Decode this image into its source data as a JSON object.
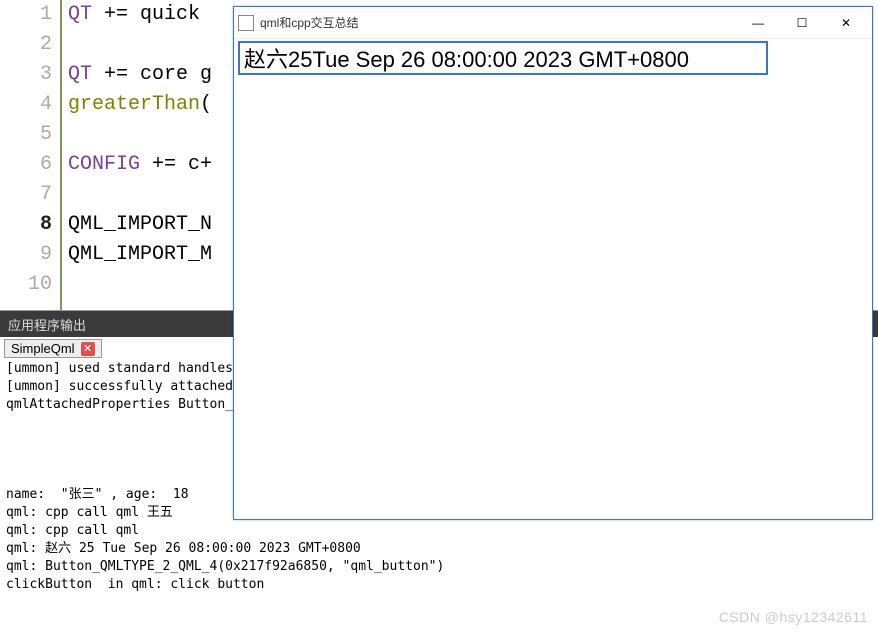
{
  "editor": {
    "lines": [
      {
        "num": "1",
        "tokens": [
          {
            "t": "QT",
            "c": "kw"
          },
          {
            "t": " += quick",
            "c": "id"
          }
        ]
      },
      {
        "num": "2",
        "tokens": []
      },
      {
        "num": "3",
        "tokens": [
          {
            "t": "QT",
            "c": "kw"
          },
          {
            "t": " += core g",
            "c": "id"
          }
        ]
      },
      {
        "num": "4",
        "tokens": [
          {
            "t": "greaterThan",
            "c": "fn"
          },
          {
            "t": "(",
            "c": "id"
          }
        ]
      },
      {
        "num": "5",
        "tokens": []
      },
      {
        "num": "6",
        "tokens": [
          {
            "t": "CONFIG",
            "c": "kw"
          },
          {
            "t": " += c+",
            "c": "id"
          }
        ]
      },
      {
        "num": "7",
        "tokens": []
      },
      {
        "num": "8",
        "tokens": [
          {
            "t": "QML_IMPORT_N",
            "c": "id"
          }
        ]
      },
      {
        "num": "9",
        "tokens": [
          {
            "t": "QML_IMPORT_M",
            "c": "id"
          }
        ]
      },
      {
        "num": "10",
        "tokens": []
      }
    ],
    "current_line_index": 7
  },
  "output": {
    "header_label": "应用程序输出",
    "tab_label": "SimpleQml",
    "close_glyph": "✕",
    "lines": [
      "[ummon] used standard handles",
      "[ummon] successfully attached",
      "qmlAttachedProperties Button_",
      "",
      "",
      "",
      "",
      "name:  \"张三\" , age:  18",
      "qml: cpp call qml 王五",
      "qml: cpp call qml",
      "qml: 赵六 25 Tue Sep 26 08:00:00 2023 GMT+0800",
      "qml: Button_QMLTYPE_2_QML_4(0x217f92a6850, \"qml_button\")",
      "clickButton  in qml: click button"
    ]
  },
  "popup": {
    "title": "qml和cpp交互总结",
    "text_value": "赵六25Tue Sep 26 08:00:00 2023 GMT+0800",
    "min_glyph": "—",
    "max_glyph": "☐",
    "close_glyph": "✕"
  },
  "watermark": "CSDN @hsy12342611"
}
